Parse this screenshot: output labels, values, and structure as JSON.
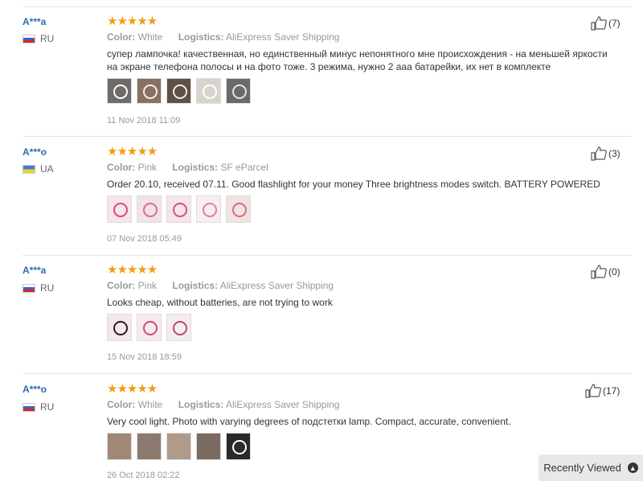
{
  "reviews": [
    {
      "user": "A***a",
      "country": "RU",
      "stars": "★★★★★",
      "color_label": "Color:",
      "color": "White",
      "logistics_label": "Logistics:",
      "logistics": "AliExpress Saver Shipping",
      "text": "супер лампочка! качественная, но единственный минус непонятного мне происхождения - на меньшей яркости на экране телефона полосы и на фото тоже. 3 режима, нужно 2 ааа батарейки, их нет в комплекте",
      "date": "11 Nov 2018 11:09",
      "likes": "(7)"
    },
    {
      "user": "A***o",
      "country": "UA",
      "stars": "★★★★★",
      "color_label": "Color:",
      "color": "Pink",
      "logistics_label": "Logistics:",
      "logistics": "SF eParcel",
      "text": "Order 20.10, received 07.11. Good flashlight for your money Three brightness modes switch. BATTERY POWERED",
      "date": "07 Nov 2018 05:49",
      "likes": "(3)"
    },
    {
      "user": "A***a",
      "country": "RU",
      "stars": "★★★★★",
      "color_label": "Color:",
      "color": "Pink",
      "logistics_label": "Logistics:",
      "logistics": "AliExpress Saver Shipping",
      "text": "Looks cheap, without batteries, are not trying to work",
      "date": "15 Nov 2018 18:59",
      "likes": "(0)"
    },
    {
      "user": "A***o",
      "country": "RU",
      "stars": "★★★★★",
      "color_label": "Color:",
      "color": "White",
      "logistics_label": "Logistics:",
      "logistics": "AliExpress Saver Shipping",
      "text": "Very cool light. Photo with varying degrees of подстетки lamp. Compact, accurate, convenient.",
      "date": "26 Oct 2018 02:22",
      "likes": "(17)"
    }
  ],
  "recently_viewed": {
    "label": "Recently Viewed"
  },
  "icons": {
    "like": "thumbs-up-icon",
    "scroll_up": "chevron-up-icon"
  }
}
